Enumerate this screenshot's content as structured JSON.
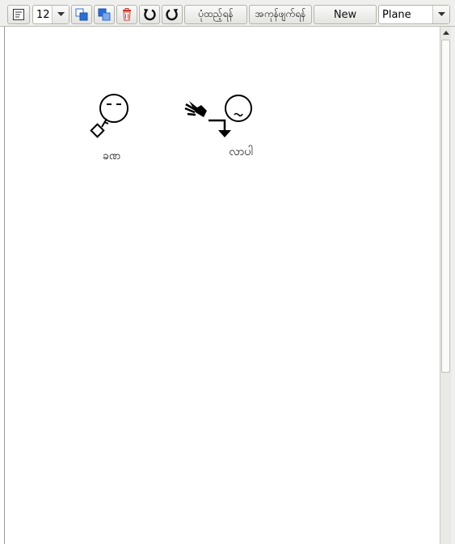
{
  "toolbar": {
    "font_size_value": "12",
    "print_label": "ပုံထည့်ရန်",
    "delete_label": "အကုန်ဖျက်ရန်",
    "new_label": "New",
    "mode_value": "Plane"
  },
  "signs": [
    {
      "gloss": "ခဏ"
    },
    {
      "gloss": "လာပါ"
    }
  ],
  "colors": {
    "toolbar_bg": "#efefed",
    "icon_blue": "#2b6fd6",
    "trash_red": "#c0392b"
  }
}
